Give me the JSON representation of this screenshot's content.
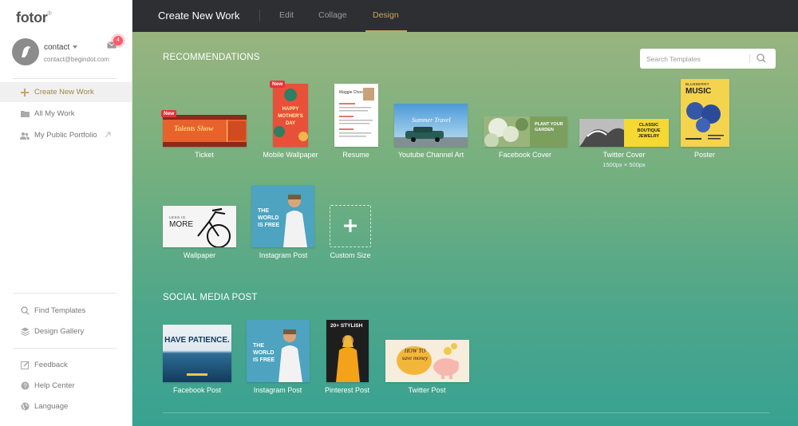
{
  "app": {
    "logo": "fotor",
    "logo_mark": "®"
  },
  "user": {
    "name": "contact",
    "email": "contact@begindot.com",
    "notifications": "4"
  },
  "sidebar": {
    "primary": [
      {
        "label": "Create New Work",
        "icon": "plus-icon",
        "active": true
      },
      {
        "label": "All My Work",
        "icon": "folder-icon"
      },
      {
        "label": "My Public Portfolio",
        "icon": "people-icon"
      }
    ],
    "secondary": [
      {
        "label": "Find Templates",
        "icon": "search-icon"
      },
      {
        "label": "Design Gallery",
        "icon": "layers-icon"
      }
    ],
    "tertiary": [
      {
        "label": "Feedback",
        "icon": "edit-icon"
      },
      {
        "label": "Help Center",
        "icon": "help-icon"
      },
      {
        "label": "Language",
        "icon": "globe-icon"
      }
    ]
  },
  "topbar": {
    "title": "Create New Work",
    "tabs": [
      {
        "label": "Edit"
      },
      {
        "label": "Collage"
      },
      {
        "label": "Design",
        "active": true
      }
    ]
  },
  "search": {
    "placeholder": "Search Templates"
  },
  "recommendations": {
    "title": "RECOMMENDATIONS",
    "new_badge": "New",
    "items": [
      {
        "label": "Ticket",
        "thumb_text": "Talents Show"
      },
      {
        "label": "Mobile Wallpaper",
        "thumb_text": "HAPPY MOTHER'S DAY"
      },
      {
        "label": "Resume",
        "thumb_text": "Maggie Choo"
      },
      {
        "label": "Youtube Channel Art",
        "thumb_text": "Summer Travel"
      },
      {
        "label": "Facebook Cover",
        "thumb_text": "PLANT YOUR GARDEN"
      },
      {
        "label": "Twitter Cover",
        "sublabel": "1500px × 500px",
        "thumb_text": "CLASSIC BOUTIQUE JEWELRY"
      },
      {
        "label": "Poster",
        "thumb_text": "MUSIC",
        "thumb_sub": "BLUEBERRY"
      },
      {
        "label": "Wallpaper",
        "thumb_text": "MORE",
        "thumb_sub": "LESS IS"
      },
      {
        "label": "Instagram Post",
        "thumb_text": "THE WORLD IS FREE"
      },
      {
        "label": "Custom Size"
      }
    ]
  },
  "social": {
    "title": "SOCIAL MEDIA POST",
    "items": [
      {
        "label": "Facebook Post",
        "thumb_text": "HAVE PATIENCE."
      },
      {
        "label": "Instagram Post",
        "thumb_text": "THE WORLD IS FREE"
      },
      {
        "label": "Pinterest Post",
        "thumb_text": "20+ STYLISH"
      },
      {
        "label": "Twitter Post",
        "thumb_text": "HOW TO save money"
      }
    ]
  }
}
